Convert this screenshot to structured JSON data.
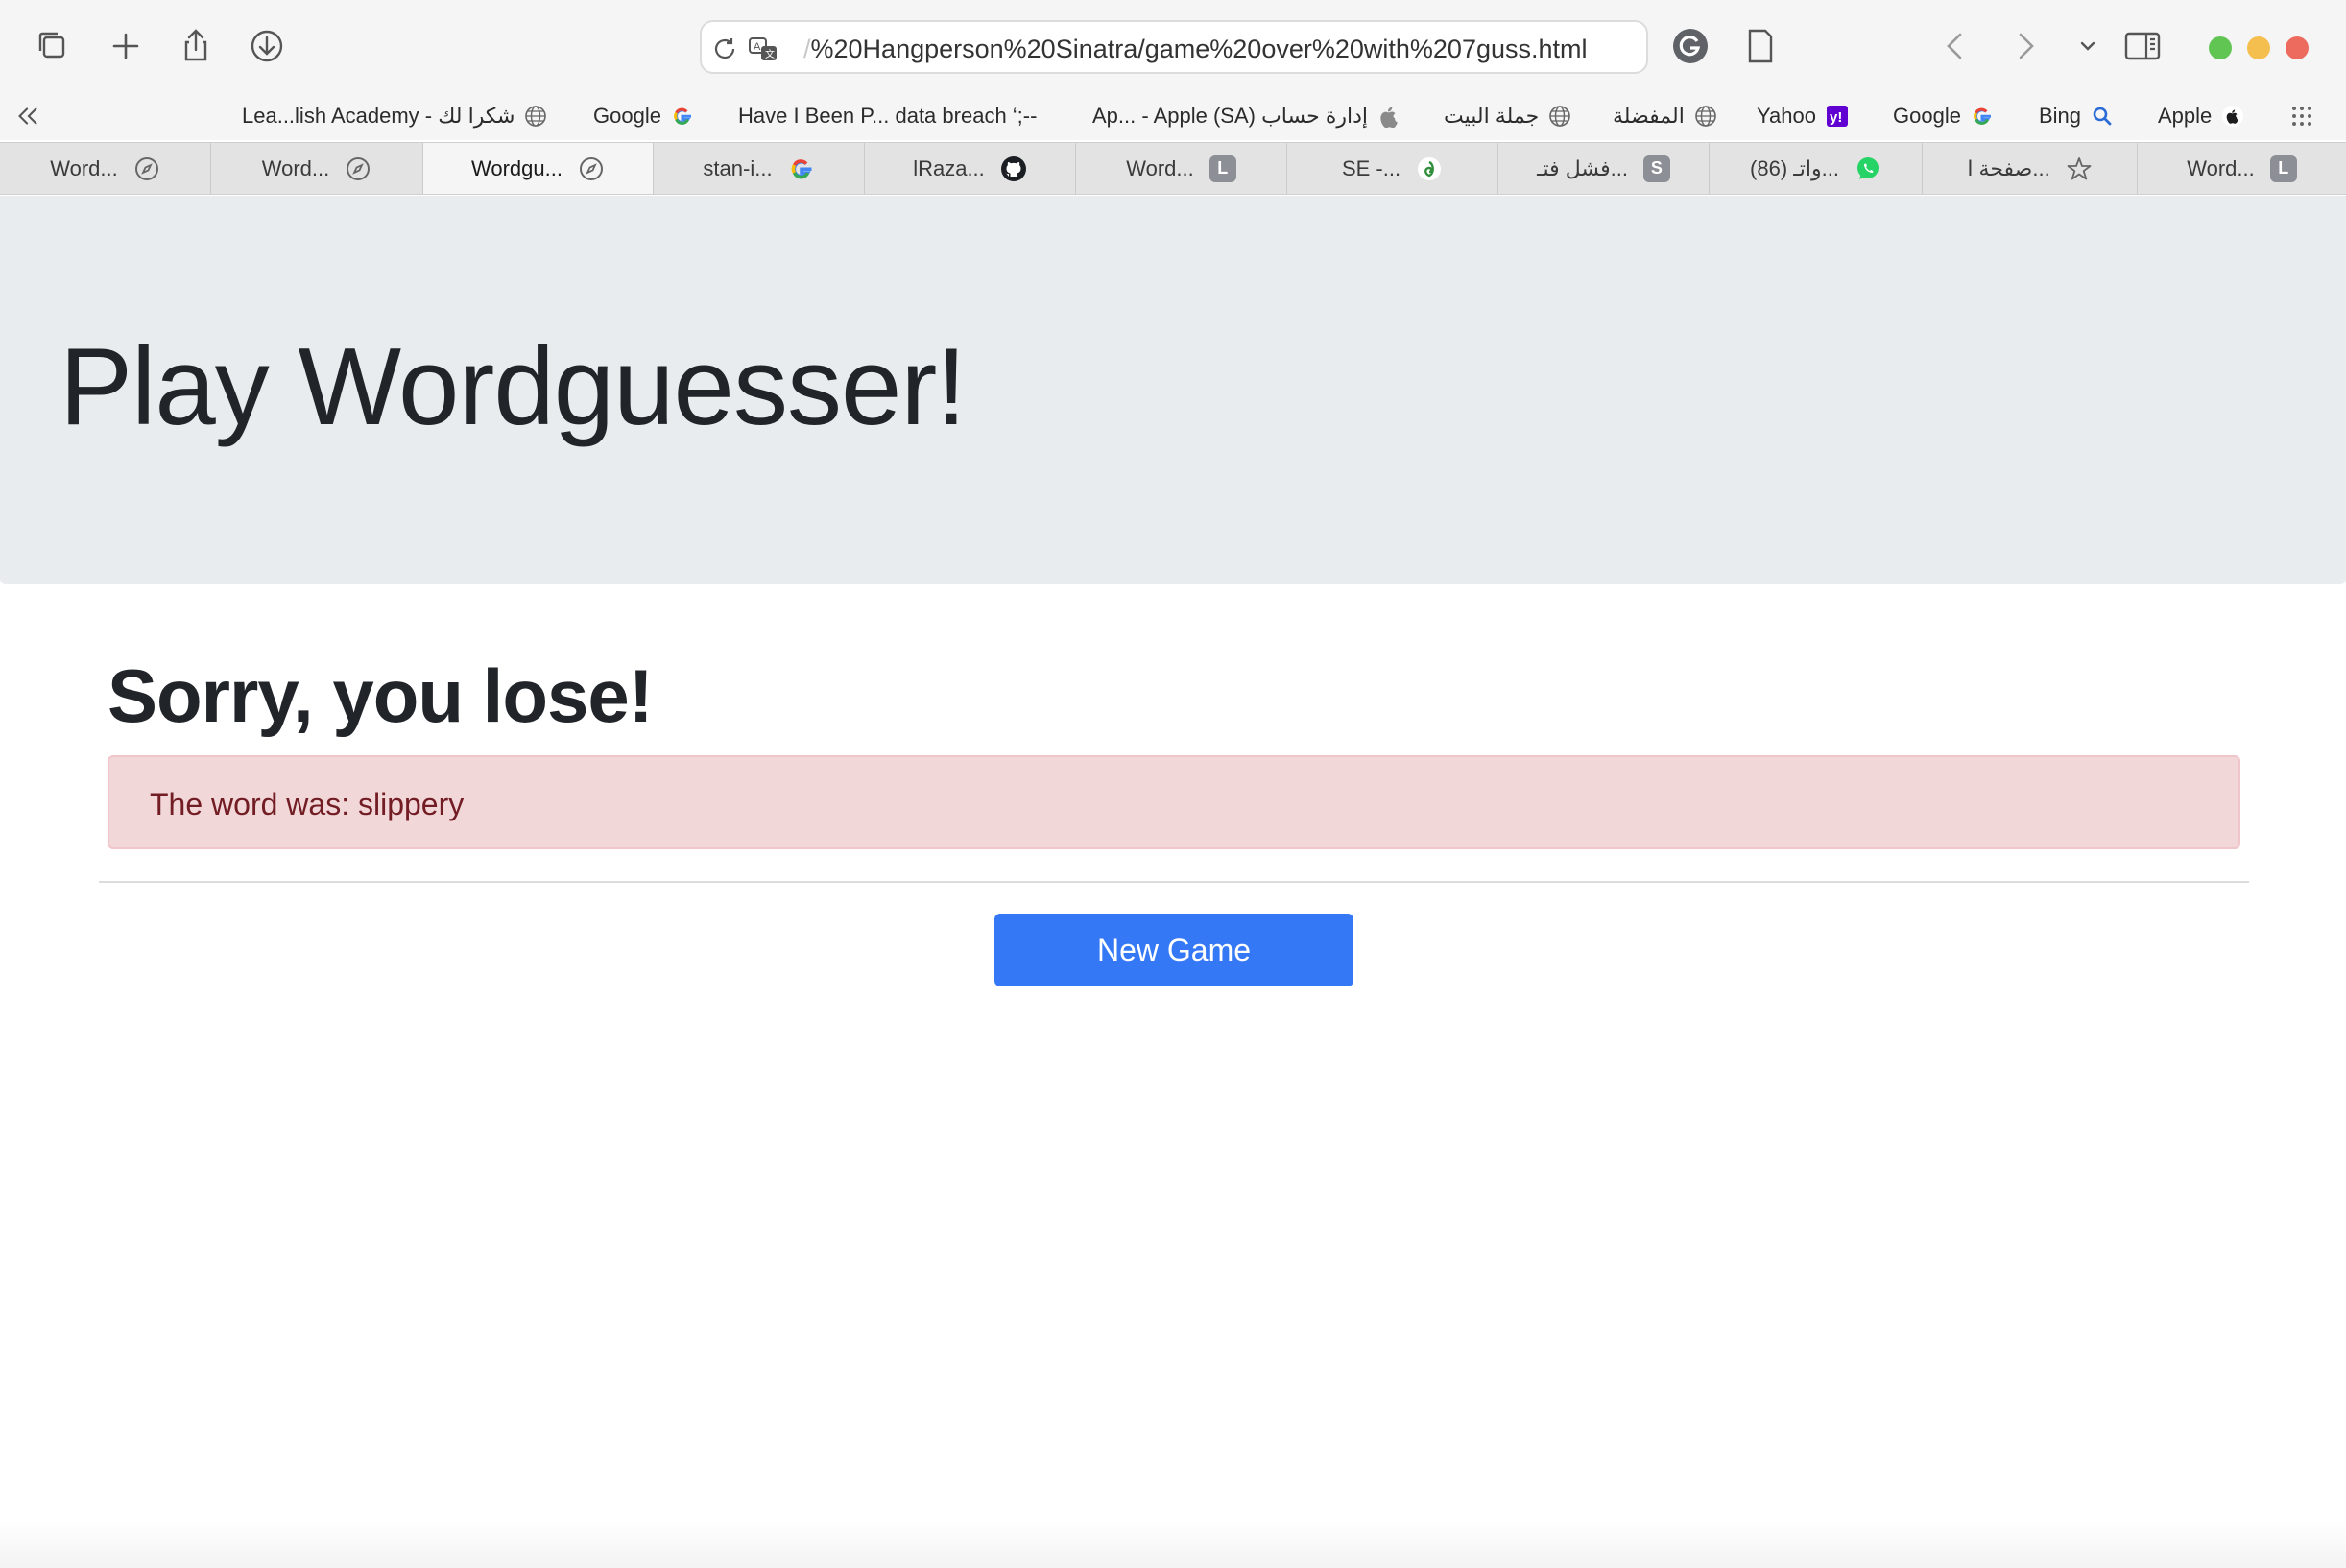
{
  "browser": {
    "url": {
      "faded_prefix": "/",
      "text": "%20Hangperson%20Sinatra/game%20over%20with%207guss.html"
    },
    "traffic_colors": {
      "green": "#61c554",
      "yellow": "#f4bf4f",
      "red": "#ed6a5e"
    },
    "bookmarks": [
      {
        "label": "Lea...lish Academy - شكرا لك",
        "icon": "globe-icon"
      },
      {
        "label": "Google",
        "icon": "google-icon"
      },
      {
        "label": "Have I Been P... data breach ‘;--",
        "icon": ""
      },
      {
        "label": "Ap... - Apple (SA) إدارة حساب",
        "icon": "apple-icon"
      },
      {
        "label": "جملة البيت",
        "icon": "globe-icon"
      },
      {
        "label": "المفضلة",
        "icon": "globe-icon"
      },
      {
        "label": "Yahoo",
        "icon": "yahoo-icon"
      },
      {
        "label": "Google",
        "icon": "google-icon"
      },
      {
        "label": "Bing",
        "icon": "search-icon"
      },
      {
        "label": "Apple",
        "icon": "apple-icon"
      }
    ],
    "tabs": [
      {
        "label": "Word...",
        "icon": "compass-icon",
        "active": false
      },
      {
        "label": "Word...",
        "icon": "compass-icon",
        "active": false
      },
      {
        "label": "Wordgu...",
        "icon": "compass-icon",
        "active": true
      },
      {
        "label": "stan-i...",
        "icon": "google-icon",
        "active": false
      },
      {
        "label": "lRaza...",
        "icon": "github-icon",
        "active": false
      },
      {
        "label": "Word...",
        "icon": "L",
        "active": false
      },
      {
        "label": "SE -...",
        "icon": "leaf-icon",
        "active": false
      },
      {
        "label": "فشل فتـ...",
        "icon": "S",
        "active": false
      },
      {
        "label": "(86) واتـ...",
        "icon": "whatsapp-icon",
        "active": false
      },
      {
        "label": "صفحة ا...",
        "icon": "star-icon",
        "active": false
      },
      {
        "label": "Word...",
        "icon": "L",
        "active": false
      }
    ]
  },
  "page": {
    "jumbotron_title": "Play Wordguesser!",
    "result_title": "Sorry, you lose!",
    "alert_text": "The word was: slippery",
    "new_game_label": "New Game",
    "colors": {
      "button": "#3478f6",
      "alert_bg": "#f2d7d9",
      "alert_text": "#721c24",
      "jumbotron_bg": "#e9ecef"
    }
  }
}
